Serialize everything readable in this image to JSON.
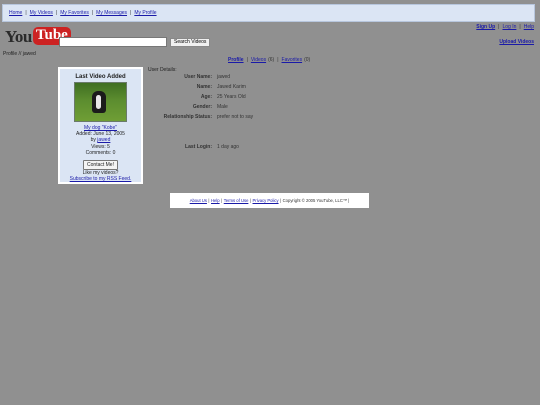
{
  "nav": {
    "items": [
      "Home",
      "My Videos",
      "My Favorites",
      "My Messages",
      "My Profile"
    ],
    "separator": "|"
  },
  "account": {
    "sign_up": "Sign Up",
    "log_in": "Log In",
    "help": "Help"
  },
  "logo": {
    "you": "You",
    "tube": "Tube"
  },
  "search": {
    "value": "",
    "button": "Search Videos"
  },
  "upload": "Upload Videos",
  "breadcrumb": "Profile // jawed",
  "tabs": {
    "profile": "Profile",
    "videos": "Videos",
    "videos_count": "(6)",
    "favorites": "Favorites",
    "favorites_count": "(0)"
  },
  "video_box": {
    "heading": "Last Video Added",
    "title": "My dog \"Kobe\"",
    "added": "Added: June 13, 2005",
    "by_label": "by",
    "by_user": "jawed",
    "views": "Views: 5",
    "comments": "Comments: 0",
    "contact_button": "Contact Me!",
    "like_text": "Like my videos?",
    "rss_link": "Subscribe to my RSS Feed."
  },
  "user_details": {
    "heading": "User Details:",
    "rows": [
      {
        "label": "User Name:",
        "value": "jawed"
      },
      {
        "label": "Name:",
        "value": "Jawed Karim"
      },
      {
        "label": "Age:",
        "value": "25 Years Old"
      },
      {
        "label": "Gender:",
        "value": "Male"
      },
      {
        "label": "Relationship Status:",
        "value": "prefer not to say"
      },
      {
        "label": "Last Login:",
        "value": "1 day ago"
      }
    ]
  },
  "footer": {
    "links": [
      "About Us",
      "Help",
      "Terms of Use",
      "Privacy Policy"
    ],
    "copyright": "Copyright © 2005 YouTube, LLC™ |"
  }
}
